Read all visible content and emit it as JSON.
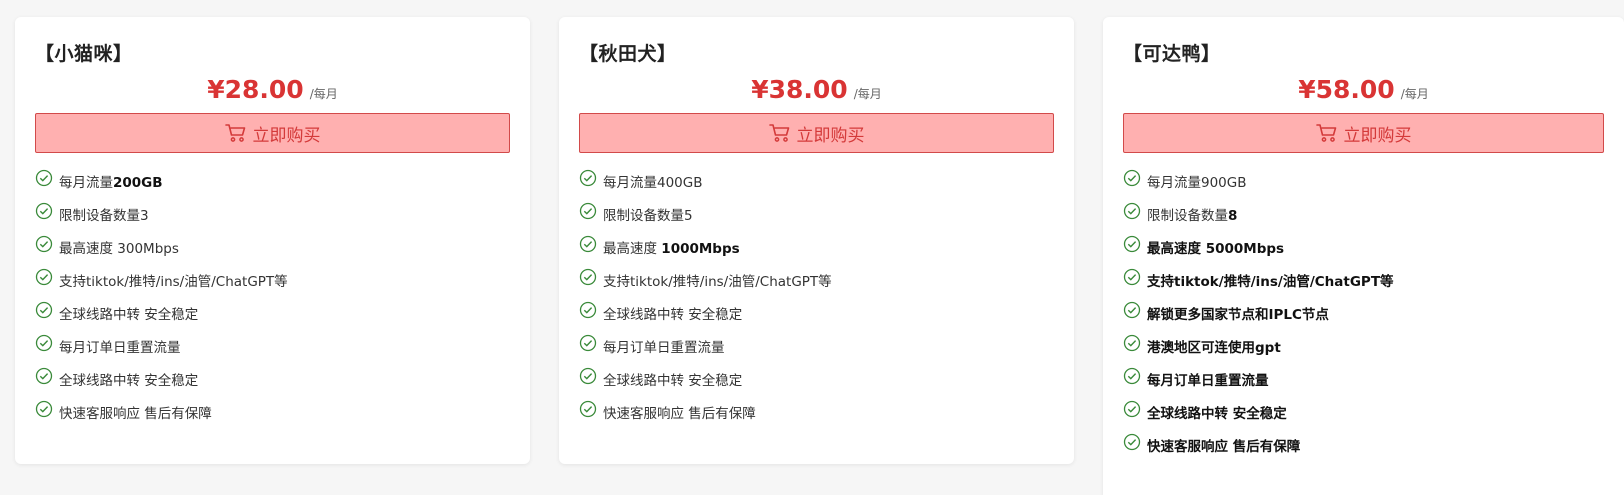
{
  "plans": [
    {
      "title": "【小猫咪】",
      "price": "¥28.00",
      "period": "/每月",
      "buy_label": "立即购买",
      "features": [
        {
          "pre": "每月流量",
          "bold": "200GB",
          "all_bold": false
        },
        {
          "pre": "限制设备数量3",
          "bold": "",
          "all_bold": false
        },
        {
          "pre": "最高速度 300Mbps",
          "bold": "",
          "all_bold": false
        },
        {
          "pre": "支持tiktok/推特/ins/油管/ChatGPT等",
          "bold": "",
          "all_bold": false
        },
        {
          "pre": "全球线路中转 安全稳定",
          "bold": "",
          "all_bold": false
        },
        {
          "pre": "每月订单日重置流量",
          "bold": "",
          "all_bold": false
        },
        {
          "pre": "全球线路中转 安全稳定",
          "bold": "",
          "all_bold": false
        },
        {
          "pre": "快速客服响应 售后有保障",
          "bold": "",
          "all_bold": false
        }
      ]
    },
    {
      "title": "【秋田犬】",
      "price": "¥38.00",
      "period": "/每月",
      "buy_label": "立即购买",
      "features": [
        {
          "pre": "每月流量400GB",
          "bold": "",
          "all_bold": false
        },
        {
          "pre": "限制设备数量5",
          "bold": "",
          "all_bold": false
        },
        {
          "pre": "最高速度 ",
          "bold": "1000Mbps",
          "all_bold": false
        },
        {
          "pre": "支持tiktok/推特/ins/油管/ChatGPT等",
          "bold": "",
          "all_bold": false
        },
        {
          "pre": "全球线路中转 安全稳定",
          "bold": "",
          "all_bold": false
        },
        {
          "pre": "每月订单日重置流量",
          "bold": "",
          "all_bold": false
        },
        {
          "pre": "全球线路中转 安全稳定",
          "bold": "",
          "all_bold": false
        },
        {
          "pre": "快速客服响应 售后有保障",
          "bold": "",
          "all_bold": false
        }
      ]
    },
    {
      "title": "【可达鸭】",
      "price": "¥58.00",
      "period": "/每月",
      "buy_label": "立即购买",
      "features": [
        {
          "pre": "每月流量900GB",
          "bold": "",
          "all_bold": false
        },
        {
          "pre": "限制设备数量",
          "bold": "8",
          "all_bold": false
        },
        {
          "pre": "最高速度 5000Mbps",
          "bold": "",
          "all_bold": true
        },
        {
          "pre": "支持tiktok/推特/ins/油管/ChatGPT等",
          "bold": "",
          "all_bold": true
        },
        {
          "pre": "解锁更多国家节点和IPLC节点",
          "bold": "",
          "all_bold": true
        },
        {
          "pre": "港澳地区可连使用gpt",
          "bold": "",
          "all_bold": true
        },
        {
          "pre": "每月订单日重置流量",
          "bold": "",
          "all_bold": true
        },
        {
          "pre": "全球线路中转 安全稳定",
          "bold": "",
          "all_bold": true
        },
        {
          "pre": "快速客服响应 售后有保障",
          "bold": "",
          "all_bold": true
        }
      ]
    }
  ],
  "colors": {
    "price": "#d93434",
    "button_bg": "#ffb0b0",
    "button_border": "#d24a4a",
    "check": "#3a8a3a"
  }
}
